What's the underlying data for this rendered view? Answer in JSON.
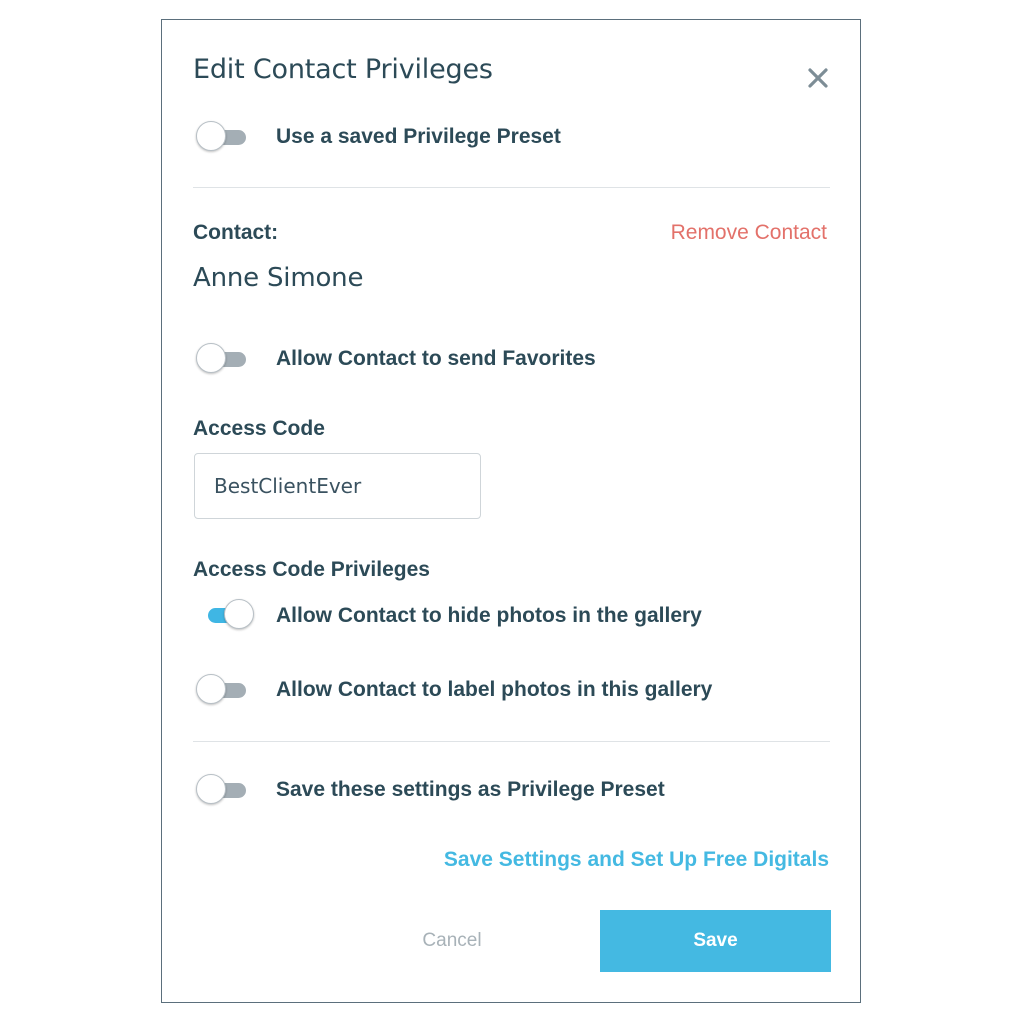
{
  "modal": {
    "title": "Edit Contact Privileges"
  },
  "preset_toggle": {
    "label": "Use a saved Privilege Preset",
    "on": false
  },
  "contact": {
    "label": "Contact:",
    "name": "Anne Simone",
    "remove_label": "Remove Contact"
  },
  "favorites_toggle": {
    "label": "Allow Contact to send Favorites",
    "on": false
  },
  "access_code": {
    "label": "Access Code",
    "value": "BestClientEver"
  },
  "access_code_privileges": {
    "label": "Access Code Privileges",
    "items": [
      {
        "label": "Allow Contact to hide photos in the gallery",
        "on": true
      },
      {
        "label": "Allow Contact to label photos in this gallery",
        "on": false
      }
    ]
  },
  "save_preset_toggle": {
    "label": "Save these settings as Privilege Preset",
    "on": false
  },
  "footer": {
    "setup_link": "Save Settings and Set Up Free Digitals",
    "cancel_label": "Cancel",
    "save_label": "Save"
  },
  "colors": {
    "text_primary": "#2c4a57",
    "accent": "#44b9e2",
    "danger": "#e3716a",
    "toggle_off": "#a4aeb5"
  }
}
